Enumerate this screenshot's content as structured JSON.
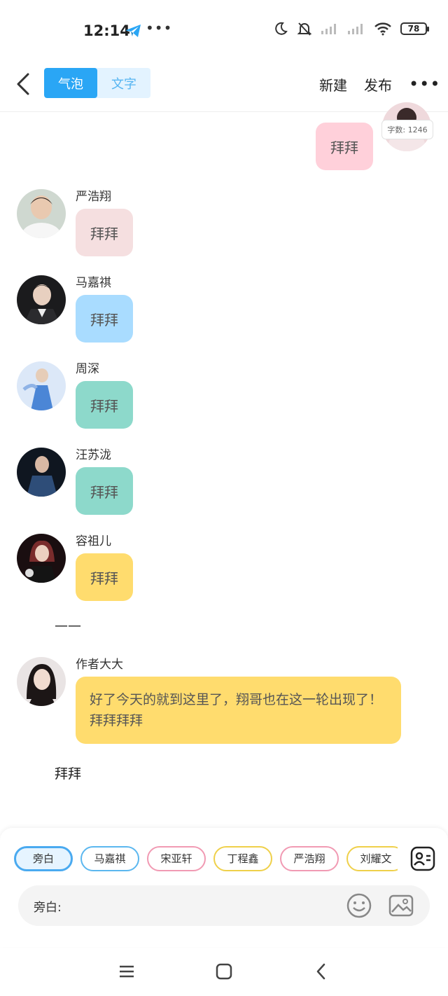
{
  "status_bar": {
    "time": "12:14",
    "dots": "•••",
    "battery": "78"
  },
  "header": {
    "tabs": [
      {
        "label": "气泡",
        "active": true
      },
      {
        "label": "文字",
        "active": false
      }
    ],
    "new_label": "新建",
    "publish_label": "发布",
    "more_label": "•••"
  },
  "word_count": "字数: 1246",
  "messages": [
    {
      "side": "right",
      "text": "拜拜",
      "bubble_color": "#ffd0da"
    },
    {
      "name": "严浩翔",
      "text": "拜拜",
      "bubble_color": "#f5dfe0"
    },
    {
      "name": "马嘉祺",
      "text": "拜拜",
      "bubble_color": "#a9dcff"
    },
    {
      "name": "周深",
      "text": "拜拜",
      "bubble_color": "#8dd9cb"
    },
    {
      "name": "汪苏泷",
      "text": "拜拜",
      "bubble_color": "#8dd9cb"
    },
    {
      "name": "容祖儿",
      "text": "拜拜",
      "bubble_color": "#ffdc6e"
    },
    {
      "name": "作者大大",
      "text": "好了今天的就到这里了，翔哥也在这一轮出现了！拜拜拜拜",
      "bubble_color": "#ffdc6e"
    }
  ],
  "narration": {
    "dash": "——",
    "bye": "拜拜"
  },
  "role_chips": [
    {
      "label": "旁白",
      "color": "#4aaaf0"
    },
    {
      "label": "马嘉祺",
      "color": "#5bb7ef"
    },
    {
      "label": "宋亚轩",
      "color": "#f19ab3"
    },
    {
      "label": "丁程鑫",
      "color": "#efd04a"
    },
    {
      "label": "严浩翔",
      "color": "#f19ab3"
    },
    {
      "label": "刘耀文",
      "color": "#efd04a"
    }
  ],
  "input": {
    "label": "旁白:"
  }
}
